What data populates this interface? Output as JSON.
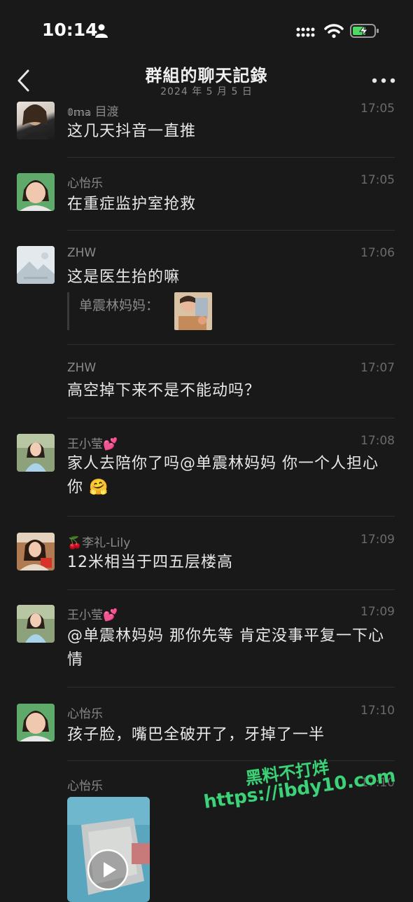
{
  "status_bar": {
    "time": "10:14",
    "icons": [
      "person-icon",
      "cellular-signal-icon",
      "wifi-icon",
      "battery-charging-icon"
    ]
  },
  "nav": {
    "title": "群組的聊天記錄",
    "subtitle": "2024 年 5 月 5 日",
    "back_icon": "chevron-left-icon",
    "more_icon": "more-dots-icon"
  },
  "messages": [
    {
      "name": "目渡",
      "name_prefix": "𝟘𝕞𝕒",
      "time": "17:05",
      "text": "这几天抖音一直推"
    },
    {
      "name": "心怡乐",
      "time": "17:05",
      "text": "在重症监护室抢救"
    },
    {
      "name": "ZHW",
      "time": "17:06",
      "text": "这是医生抬的嘛",
      "quote": "单震林妈妈："
    },
    {
      "name": "ZHW",
      "time": "17:07",
      "text": "高空掉下来不是不能动吗？"
    },
    {
      "name": "王小莹💕",
      "time": "17:08",
      "text": "家人去陪你了吗@单震林妈妈  你一个人担心你  🤗"
    },
    {
      "name": "🍒李礼-Lily",
      "time": "17:09",
      "text": "12米相当于四五层楼高"
    },
    {
      "name": "王小莹💕",
      "time": "17:09",
      "text": "@单震林妈妈 那你先等 肯定没事平复一下心情"
    },
    {
      "name": "心怡乐",
      "time": "17:10",
      "text": "孩子脸，嘴巴全破开了，牙掉了一半"
    },
    {
      "name": "心怡乐",
      "time": "17:10",
      "text": ""
    }
  ],
  "watermark": {
    "line1": "黑料不打烊",
    "line2": "https://ibdy10.com"
  },
  "colors": {
    "background": "#191919",
    "accent_watermark": "#3fd07a"
  }
}
